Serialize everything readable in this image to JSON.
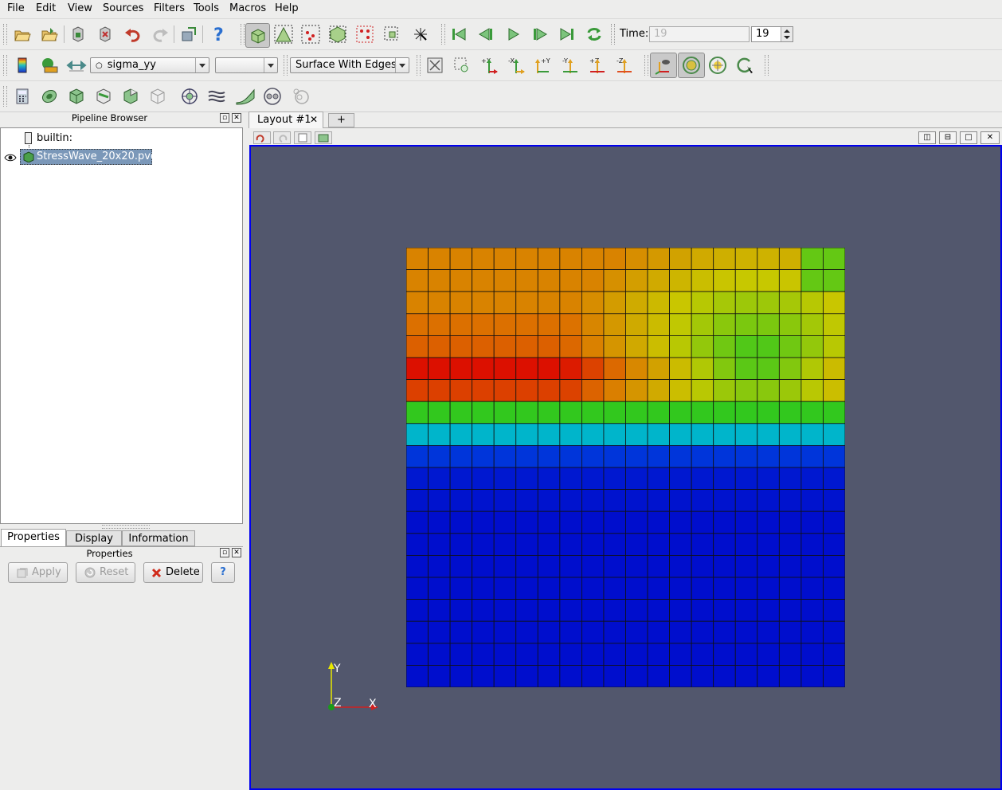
{
  "menu": [
    "File",
    "Edit",
    "View",
    "Sources",
    "Filters",
    "Tools",
    "Macros",
    "Help"
  ],
  "time": {
    "label": "Time:",
    "field_value": "19",
    "spin_value": "19"
  },
  "toolbar": {
    "array_combo": "sigma_yy",
    "array_icon": "point-data-icon",
    "component_combo": "",
    "representation_combo": "Surface With Edges",
    "axis_labels": {
      "px": "+X",
      "mx": "-X",
      "py": "+Y",
      "my": "-Y",
      "pz": "+Z",
      "mz": "-Z"
    }
  },
  "pipeline": {
    "title": "Pipeline Browser",
    "items": [
      {
        "label": "builtin:"
      },
      {
        "label": "StressWave_20x20.pvd",
        "selected": true,
        "visible": true
      }
    ]
  },
  "layout_tabs": [
    {
      "label": "Layout #1"
    },
    {
      "label": "+"
    }
  ],
  "bottom_tabs": [
    "Properties",
    "Display",
    "Information"
  ],
  "properties": {
    "title": "Properties",
    "apply": "Apply",
    "reset": "Reset",
    "delete": "Delete",
    "help": "?"
  },
  "orientation_axes": {
    "x": "X",
    "y": "Y",
    "z": "Z"
  },
  "mesh": {
    "rows": 20,
    "cols": 20,
    "field": "sigma_yy",
    "background_color": "#52576d",
    "edge_color": "#111111"
  },
  "colors": {
    "selection": "#7b98b9",
    "viewport_border": "#0000ee"
  }
}
